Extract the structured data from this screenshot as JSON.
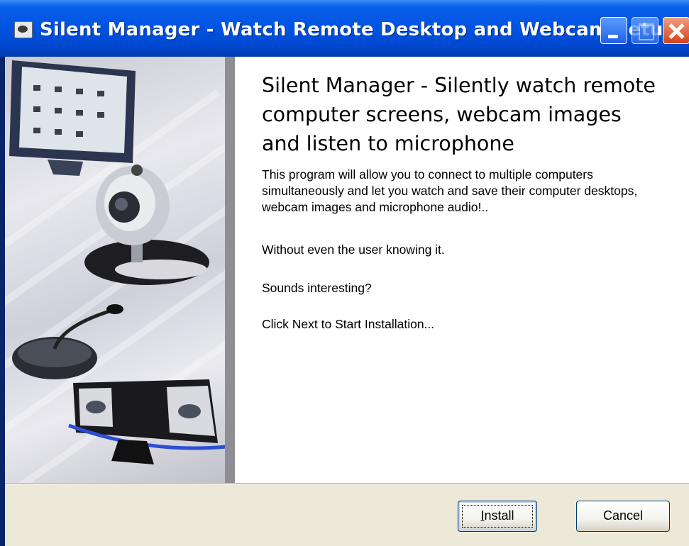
{
  "window": {
    "title": "Silent Manager - Watch Remote Desktop and Webcam Setup"
  },
  "welcome": {
    "heading": "Silent Manager - Silently watch remote computer screens, webcam images and listen to microphone",
    "paragraphs": [
      "This program will allow you to connect to multiple computers simultaneously and let you watch and save their computer desktops, webcam images and microphone audio!..",
      "Without even the user knowing it.",
      "Sounds interesting?",
      "Click Next to Start Installation..."
    ]
  },
  "buttons": {
    "install_label": "Install",
    "install_mnemonic": "I",
    "install_rest": "nstall",
    "cancel_label": "Cancel"
  },
  "icons": {
    "app": "setup-icon",
    "minimize": "minimize-icon",
    "maximize": "maximize-icon",
    "close": "close-icon"
  },
  "colors": {
    "titlebar": "#0054e3",
    "client_bg": "#ece9d8",
    "button_border": "#003c74"
  }
}
